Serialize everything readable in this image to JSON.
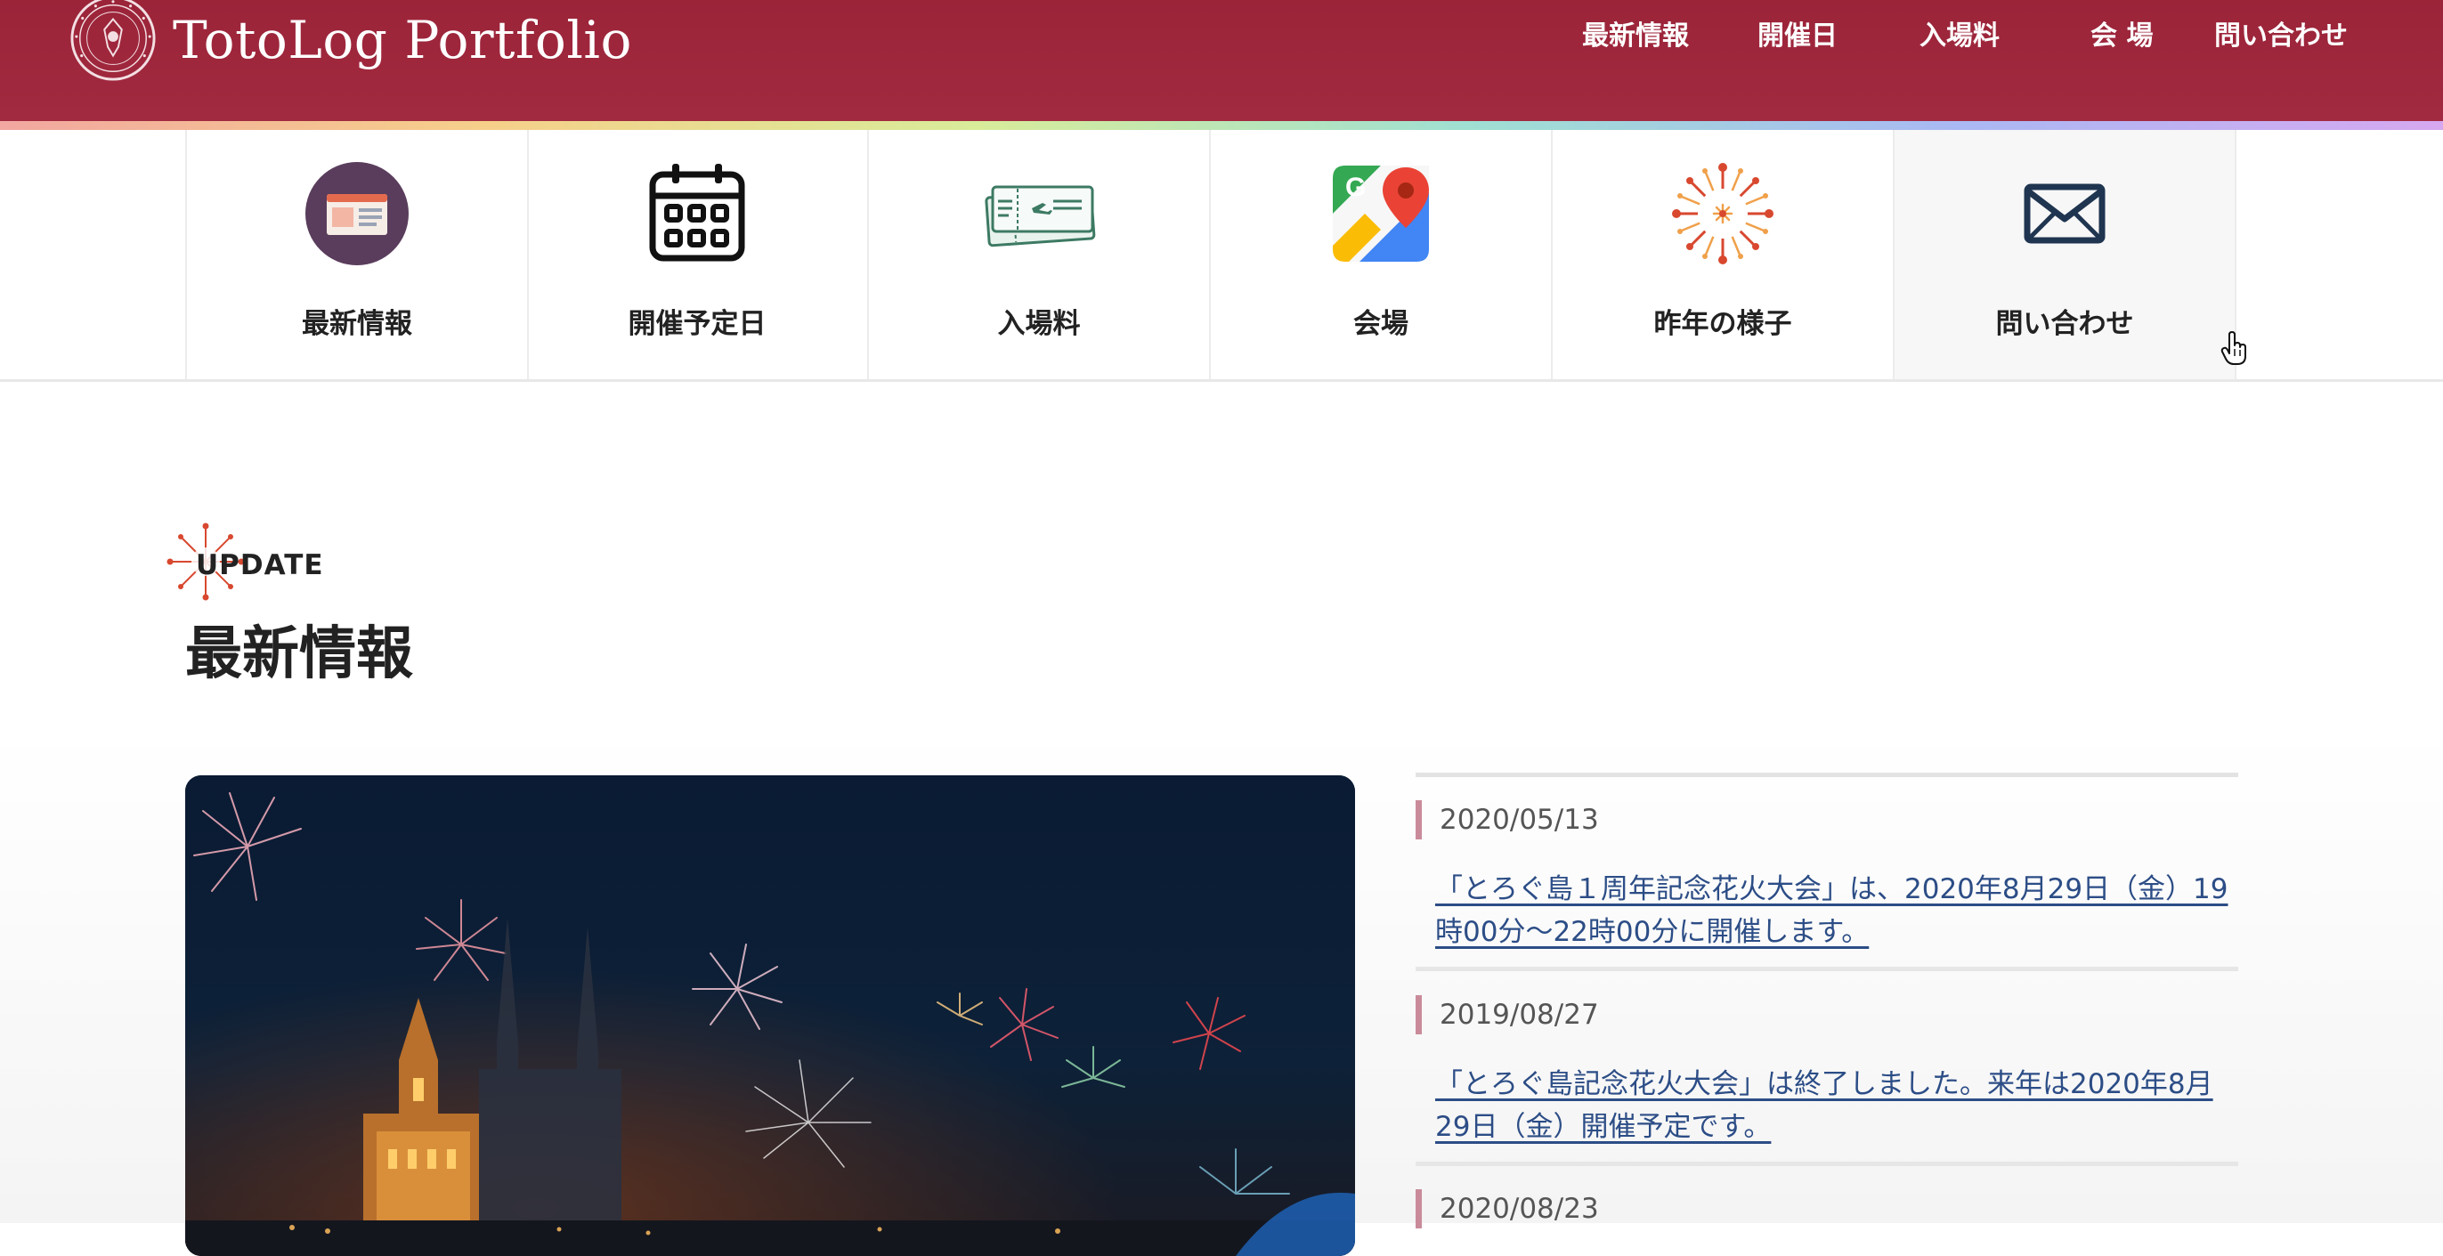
{
  "header": {
    "brand": "TotoLog Portfolio",
    "nav": [
      "最新情報",
      "開催日",
      "入場料",
      "会 場",
      "問い合わせ"
    ]
  },
  "menu": {
    "items": [
      {
        "label": "最新情報",
        "icon": "newspaper-icon"
      },
      {
        "label": "開催予定日",
        "icon": "calendar-icon"
      },
      {
        "label": "入場料",
        "icon": "ticket-icon"
      },
      {
        "label": "会場",
        "icon": "map-icon"
      },
      {
        "label": "昨年の様子",
        "icon": "firework-icon"
      },
      {
        "label": "問い合わせ",
        "icon": "mail-icon"
      }
    ]
  },
  "section": {
    "eyebrow": "UPDATE",
    "title": "最新情報"
  },
  "news": [
    {
      "date": "2020/05/13",
      "text": "「とろぐ島１周年記念花火大会」は、2020年8月29日（金）19時00分〜22時00分に開催します。"
    },
    {
      "date": "2019/08/27",
      "text": "「とろぐ島記念花火大会」は終了しました。来年は2020年8月29日（金）開催予定です。"
    },
    {
      "date": "2020/08/23",
      "text": ""
    }
  ],
  "colors": {
    "header": "#9b2439",
    "link": "#2c4d86",
    "date_bar": "#c98b9a"
  }
}
